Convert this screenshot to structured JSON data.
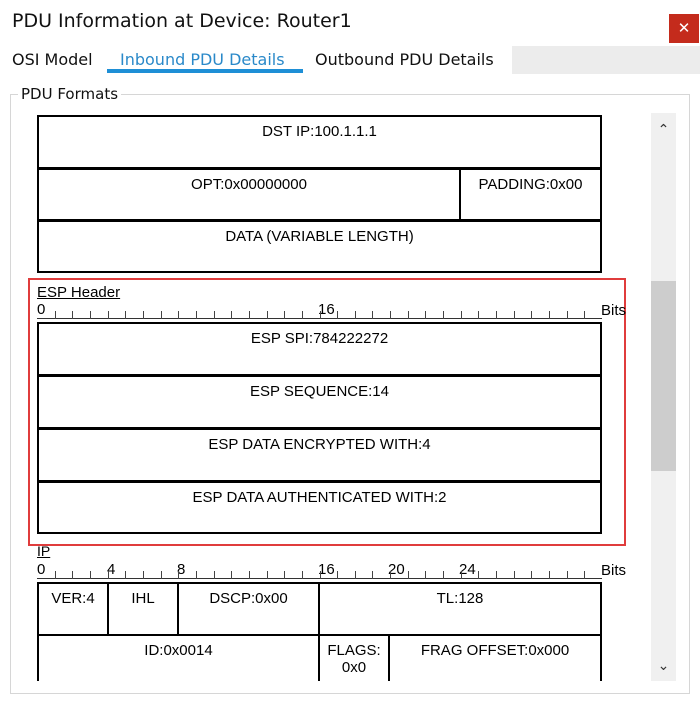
{
  "window": {
    "title": "PDU Information at Device: Router1",
    "close_glyph": "✕"
  },
  "tabs": [
    {
      "label": "OSI Model",
      "active": false
    },
    {
      "label": "Inbound PDU Details",
      "active": true
    },
    {
      "label": "Outbound PDU Details",
      "active": false
    }
  ],
  "group": {
    "label": "PDU Formats"
  },
  "top_rows": {
    "dst_ip": "DST IP:100.1.1.1",
    "opt": "OPT:0x00000000",
    "padding": "PADDING:0x00",
    "data": "DATA (VARIABLE LENGTH)"
  },
  "esp": {
    "label": "ESP Header",
    "ruler": {
      "start": "0",
      "mid": "16",
      "unit": "Bits"
    },
    "fields": {
      "spi": "ESP SPI:784222272",
      "sequence": "ESP SEQUENCE:14",
      "encrypted": "ESP DATA ENCRYPTED WITH:4",
      "authenticated": "ESP DATA AUTHENTICATED WITH:2"
    }
  },
  "ip": {
    "label": "IP",
    "ruler": {
      "t0": "0",
      "t4": "4",
      "t8": "8",
      "t16": "16",
      "t20": "20",
      "t24": "24",
      "unit": "Bits"
    },
    "fields": {
      "ver": "VER:4",
      "ihl": "IHL",
      "dscp": "DSCP:0x00",
      "tl": "TL:128",
      "id": "ID:0x0014",
      "flags_1": "FLAGS:",
      "flags_2": "0x0",
      "frag": "FRAG OFFSET:0x000"
    }
  },
  "scrollbar": {
    "up_icon": "chevron-up",
    "down_icon": "chevron-down",
    "position": 0.45
  },
  "colors": {
    "accent": "#1e8fd6",
    "highlight": "#e03c3c",
    "close": "#c42b1c"
  }
}
